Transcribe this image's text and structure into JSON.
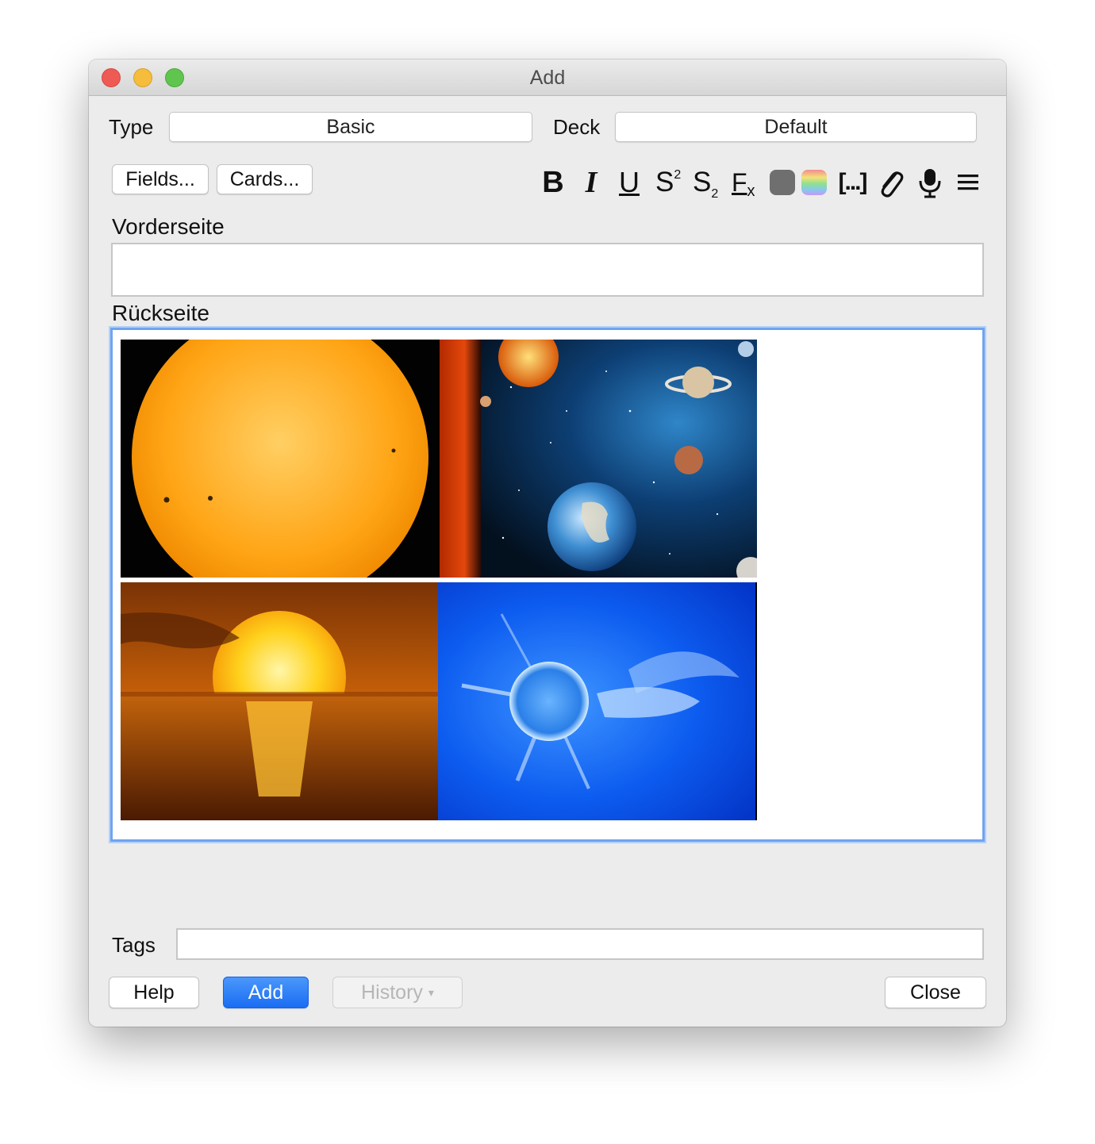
{
  "window": {
    "title": "Add"
  },
  "type": {
    "label": "Type",
    "value": "Basic"
  },
  "deck": {
    "label": "Deck",
    "value": "Default"
  },
  "buttons": {
    "fields": "Fields...",
    "cards": "Cards..."
  },
  "toolbar": {
    "bold": "B",
    "italic": "I",
    "underline": "U",
    "superscript_base": "S",
    "superscript_mark": "2",
    "subscript_base": "S",
    "subscript_mark": "2",
    "clear_format_base": "F",
    "clear_format_mark": "x",
    "cloze": "[...]",
    "text_color": "#6f6f6f"
  },
  "fields": [
    {
      "label": "Vorderseite",
      "value": ""
    },
    {
      "label": "Rückseite",
      "images": [
        "sun-disk",
        "solar-system",
        "sunset-over-sea",
        "blue-solar-flare"
      ]
    }
  ],
  "tags": {
    "label": "Tags",
    "value": ""
  },
  "footer": {
    "help": "Help",
    "add": "Add",
    "history": "History",
    "history_arrow": "▾",
    "close": "Close"
  },
  "colors": {
    "accent": "#1a6df3",
    "focus_ring": "#6fa4ee"
  }
}
